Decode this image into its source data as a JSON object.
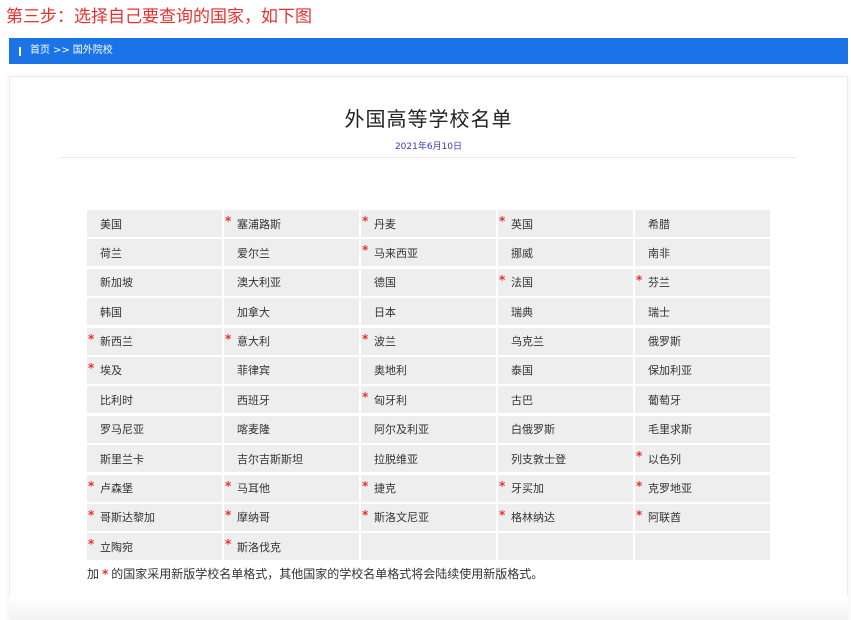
{
  "step_heading": "第三步：选择自己要查询的国家，如下图",
  "breadcrumb": {
    "home": "首页",
    "separator": ">>",
    "current": "国外院校"
  },
  "page": {
    "title": "外国高等学校名单",
    "date": "2021年6月10日"
  },
  "colors": {
    "accent_blue": "#1a74e8",
    "star_red": "#e8312f",
    "heading_red": "#e8312f",
    "date_blue": "#3a38b8",
    "cell_bg": "#eeeeee"
  },
  "countries": [
    {
      "name": "美国",
      "starred": false
    },
    {
      "name": "塞浦路斯",
      "starred": true
    },
    {
      "name": "丹麦",
      "starred": true
    },
    {
      "name": "英国",
      "starred": true
    },
    {
      "name": "希腊",
      "starred": false
    },
    {
      "name": "荷兰",
      "starred": false
    },
    {
      "name": "爱尔兰",
      "starred": false
    },
    {
      "name": "马来西亚",
      "starred": true
    },
    {
      "name": "挪威",
      "starred": false
    },
    {
      "name": "南非",
      "starred": false
    },
    {
      "name": "新加坡",
      "starred": false
    },
    {
      "name": "澳大利亚",
      "starred": false
    },
    {
      "name": "德国",
      "starred": false
    },
    {
      "name": "法国",
      "starred": true
    },
    {
      "name": "芬兰",
      "starred": true
    },
    {
      "name": "韩国",
      "starred": false
    },
    {
      "name": "加拿大",
      "starred": false
    },
    {
      "name": "日本",
      "starred": false
    },
    {
      "name": "瑞典",
      "starred": false
    },
    {
      "name": "瑞士",
      "starred": false
    },
    {
      "name": "新西兰",
      "starred": true
    },
    {
      "name": "意大利",
      "starred": true
    },
    {
      "name": "波兰",
      "starred": true
    },
    {
      "name": "乌克兰",
      "starred": false
    },
    {
      "name": "俄罗斯",
      "starred": false
    },
    {
      "name": "埃及",
      "starred": true
    },
    {
      "name": "菲律宾",
      "starred": false
    },
    {
      "name": "奥地利",
      "starred": false
    },
    {
      "name": "泰国",
      "starred": false
    },
    {
      "name": "保加利亚",
      "starred": false
    },
    {
      "name": "比利时",
      "starred": false
    },
    {
      "name": "西班牙",
      "starred": false
    },
    {
      "name": "匈牙利",
      "starred": true
    },
    {
      "name": "古巴",
      "starred": false
    },
    {
      "name": "葡萄牙",
      "starred": false
    },
    {
      "name": "罗马尼亚",
      "starred": false
    },
    {
      "name": "喀麦隆",
      "starred": false
    },
    {
      "name": "阿尔及利亚",
      "starred": false
    },
    {
      "name": "白俄罗斯",
      "starred": false
    },
    {
      "name": "毛里求斯",
      "starred": false
    },
    {
      "name": "斯里兰卡",
      "starred": false
    },
    {
      "name": "吉尔吉斯斯坦",
      "starred": false
    },
    {
      "name": "拉脱维亚",
      "starred": false
    },
    {
      "name": "列支敦士登",
      "starred": false
    },
    {
      "name": "以色列",
      "starred": true
    },
    {
      "name": "卢森堡",
      "starred": true
    },
    {
      "name": "马耳他",
      "starred": true
    },
    {
      "name": "捷克",
      "starred": true
    },
    {
      "name": "牙买加",
      "starred": true
    },
    {
      "name": "克罗地亚",
      "starred": true
    },
    {
      "name": "哥斯达黎加",
      "starred": true
    },
    {
      "name": "摩纳哥",
      "starred": true
    },
    {
      "name": "斯洛文尼亚",
      "starred": true
    },
    {
      "name": "格林纳达",
      "starred": true
    },
    {
      "name": "阿联酋",
      "starred": true
    },
    {
      "name": "立陶宛",
      "starred": true
    },
    {
      "name": "斯洛伐克",
      "starred": true
    },
    {
      "name": "",
      "starred": false
    },
    {
      "name": "",
      "starred": false
    },
    {
      "name": "",
      "starred": false
    }
  ],
  "star_symbol": "*",
  "footnote": {
    "prefix": "加",
    "star": "*",
    "text": "的国家采用新版学校名单格式，其他国家的学校名单格式将会陆续使用新版格式。"
  }
}
